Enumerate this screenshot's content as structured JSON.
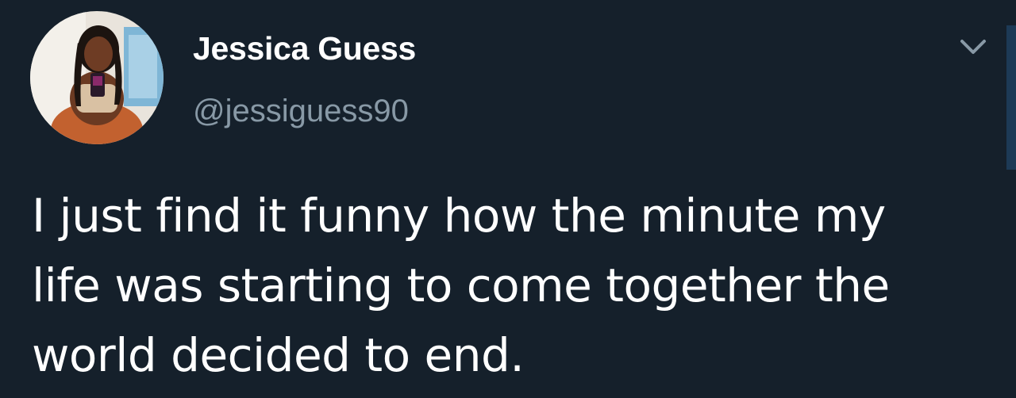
{
  "tweet": {
    "author": {
      "display_name": "Jessica Guess",
      "handle": "@jessiguess90",
      "avatar_icon": "profile-photo"
    },
    "menu_icon": "chevron-down-icon",
    "text_lines": [
      "I just find it funny how the minute my",
      "life was starting to come together the",
      "world decided to end."
    ]
  },
  "colors": {
    "background": "#15202b",
    "primary_text": "#ffffff",
    "secondary_text": "#8899a6",
    "scrollbar": "#1d3a56"
  }
}
